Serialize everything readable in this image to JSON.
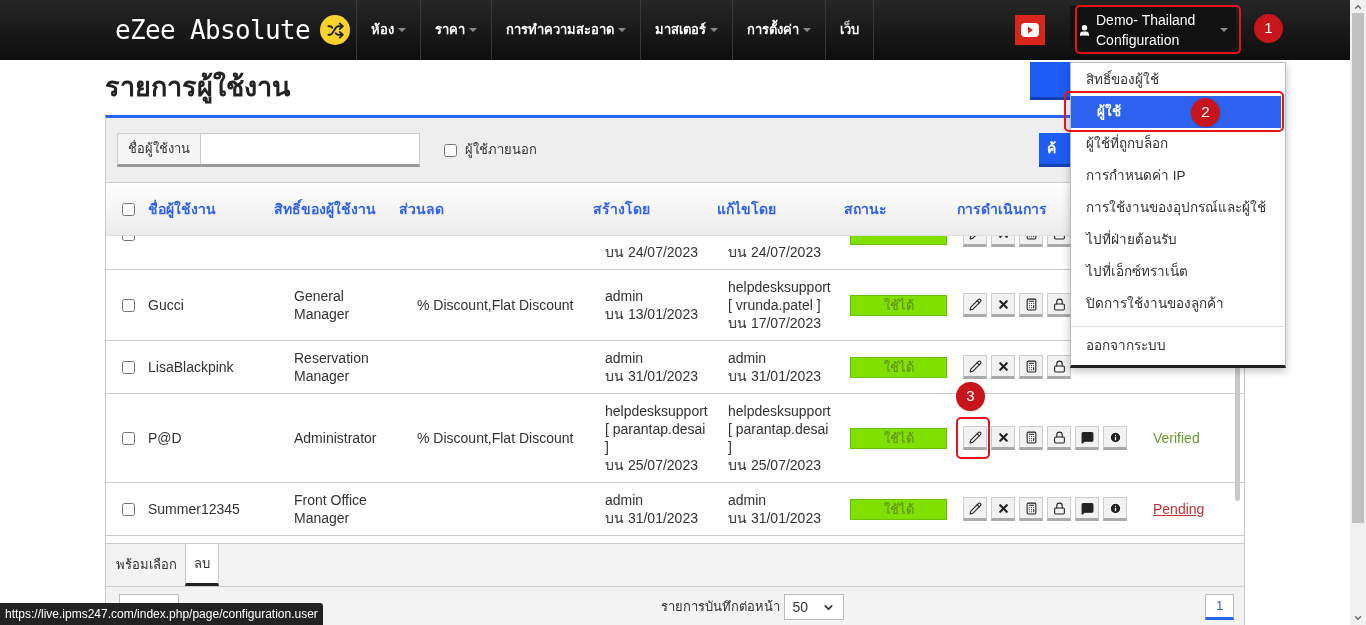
{
  "brand": "eZee Absolute",
  "nav": [
    {
      "label": "ห้อง",
      "has_menu": true
    },
    {
      "label": "ราคา",
      "has_menu": true
    },
    {
      "label": "การทำความสะอาด",
      "has_menu": true
    },
    {
      "label": "มาสเตอร์",
      "has_menu": true
    },
    {
      "label": "การตั้งค่า",
      "has_menu": true
    },
    {
      "label": "เว็บ",
      "has_menu": false
    }
  ],
  "user_menu": {
    "label": "Demo- Thailand Configuration",
    "items": [
      {
        "label": "สิทธิ์ของผู้ใช้",
        "selected": false
      },
      {
        "label": "ผู้ใช้",
        "selected": true
      },
      {
        "label": "ผู้ใช้ที่ถูกบล็อก",
        "selected": false
      },
      {
        "label": "การกำหนดค่า IP",
        "selected": false
      },
      {
        "label": "การใช้งานของอุปกรณ์และผู้ใช้",
        "selected": false
      },
      {
        "label": "ไปที่ฝ่ายต้อนรับ",
        "selected": false
      },
      {
        "label": "ไปที่เอ็กซ์ทราเน็ต",
        "selected": false
      },
      {
        "label": "ปิดการใช้งานของลูกค้า",
        "selected": false
      }
    ],
    "footer_item": "ออกจากระบบ"
  },
  "page_title": "รายการผู้ใช้งาน",
  "filter": {
    "label": "ชื่อผู้ใช้งาน",
    "external": {
      "label": "ผู้ใช้ภายนอก",
      "checked": false
    },
    "search_button": "ค้"
  },
  "table": {
    "select_all": false,
    "first_row_cut": true,
    "columns": [
      "ชื่อผู้ใช้งาน",
      "สิทธิ์ของผู้ใช้งาน",
      "ส่วนลด",
      "สร้างโดย",
      "แก้ไขโดย",
      "สถานะ",
      "การดำเนินการ"
    ],
    "rows": [
      {
        "checked": false,
        "created": [
          "บน 24/07/2023"
        ],
        "edited": [
          "บน 24/07/2023"
        ]
      },
      {
        "checked": false,
        "username": "Gucci",
        "role": [
          "General",
          "Manager"
        ],
        "discount": "% Discount,Flat Discount",
        "created": [
          "admin",
          "บน 13/01/2023"
        ],
        "edited": [
          "helpdesksupport",
          "[ vrunda.patel ]",
          "บน 17/07/2023"
        ],
        "status": "ใช้ได้"
      },
      {
        "checked": false,
        "username": "LisaBlackpink",
        "role": [
          "Reservation",
          "Manager"
        ],
        "created": [
          "admin",
          "บน 31/01/2023"
        ],
        "edited": [
          "admin",
          "บน 31/01/2023"
        ],
        "status": "ใช้ได้"
      },
      {
        "checked": false,
        "username": "P@D",
        "role": [
          "Administrator"
        ],
        "discount": "% Discount,Flat Discount",
        "created": [
          "helpdesksupport",
          "[ parantap.desai",
          "]",
          "บน 25/07/2023"
        ],
        "edited": [
          "helpdesksupport",
          "[ parantap.desai",
          "]",
          "บน 25/07/2023"
        ],
        "status": "ใช้ได้",
        "verification": {
          "text": "Verified",
          "kind": "verified"
        }
      },
      {
        "checked": false,
        "username": "Summer12345",
        "role": [
          "Front Office",
          "Manager"
        ],
        "created": [
          "admin",
          "บน 31/01/2023"
        ],
        "edited": [
          "admin",
          "บน 31/01/2023"
        ],
        "status": "ใช้ได้",
        "verification": {
          "text": "Pending",
          "kind": "pending"
        }
      }
    ]
  },
  "bottom_tabs": [
    {
      "label": "พร้อมเลือก",
      "selected": false
    },
    {
      "label": "ลบ",
      "selected": true
    }
  ],
  "footer": {
    "per_page_label": "รายการบันทึกต่อหน้า",
    "per_page": "50",
    "pages": [
      {
        "label": "1",
        "selected": true
      }
    ]
  },
  "annotations": [
    "1",
    "2",
    "3"
  ],
  "status_url": "https://live.ipms247.com/index.php/page/configuration.user"
}
